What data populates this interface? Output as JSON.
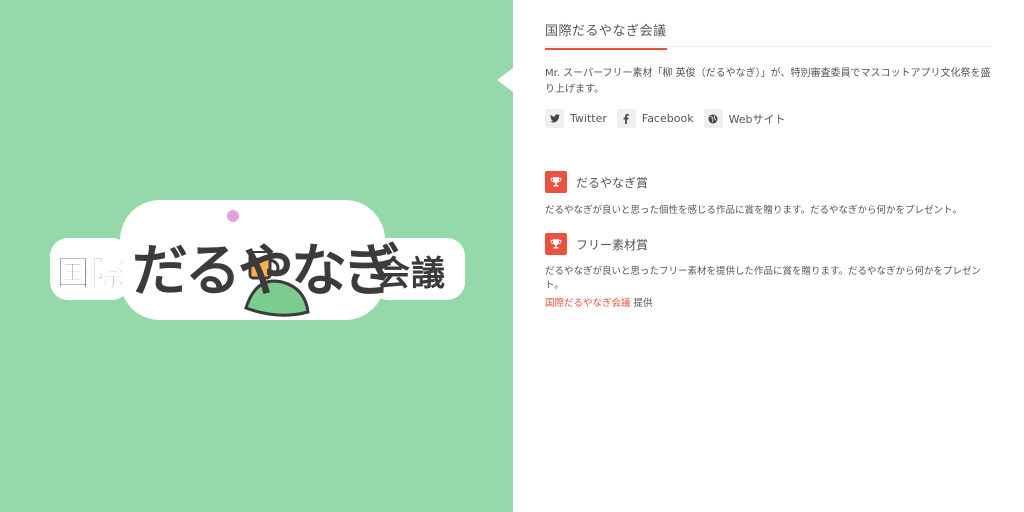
{
  "hero": {
    "logo_text": "国際だるやなぎ会議",
    "logo_prefix": "国際",
    "logo_main": "だるやなぎ",
    "logo_suffix": "会議",
    "background_color": "#95d8aa"
  },
  "sponsor": {
    "title": "国際だるやなぎ会議",
    "description": "Mr. スーパーフリー素材「柳 英俊（だるやなぎ）」が、特別審査委員でマスコットアプリ文化祭を盛り上げます。",
    "links": [
      {
        "label": "Twitter",
        "icon": "twitter-icon"
      },
      {
        "label": "Facebook",
        "icon": "facebook-icon"
      },
      {
        "label": "Webサイト",
        "icon": "globe-icon"
      }
    ]
  },
  "awards": [
    {
      "title": "だるやなぎ賞",
      "icon": "trophy-icon",
      "description": "だるやなぎが良いと思った個性を感じる作品に賞を贈ります。だるやなぎから何かをプレゼント。"
    },
    {
      "title": "フリー素材賞",
      "icon": "trophy-icon",
      "description": "だるやなぎが良いと思ったフリー素材を提供した作品に賞を贈ります。だるやなぎから何かをプレゼント。"
    }
  ],
  "credit": {
    "link_text": "国際だるやなぎ会議",
    "suffix": "提供"
  },
  "colors": {
    "accent": "#e8523f",
    "panel_bg": "#95d8aa",
    "icon_bg": "#efefef"
  }
}
